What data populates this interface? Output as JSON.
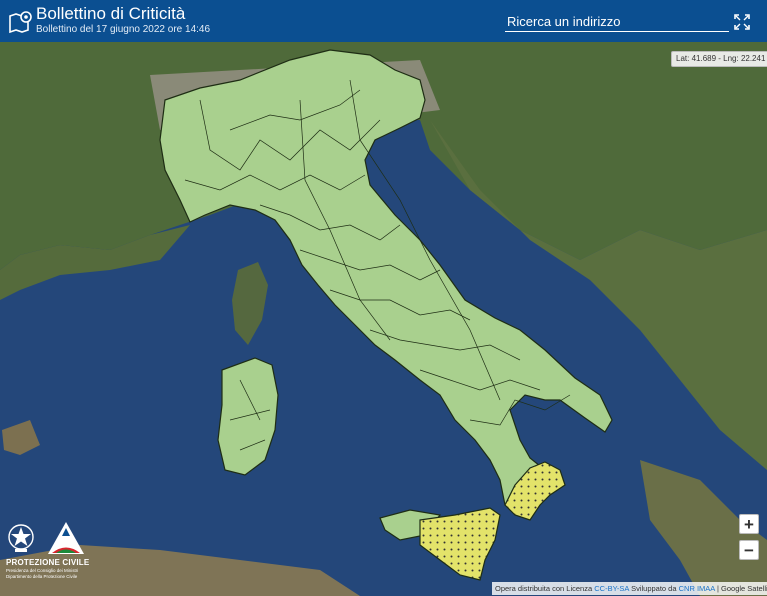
{
  "header": {
    "title": "Bollettino di Criticità",
    "subtitle": "Bollettino del 17 giugno 2022 ore 14:46",
    "search_placeholder": "Ricerca un indirizzo",
    "fullscreen_icon": "fullscreen-expand-icon",
    "logo_icon": "map-pin-icon"
  },
  "coords": {
    "text": "Lat: 41.689 - Lng: 22.241"
  },
  "zoom": {
    "in_label": "+",
    "out_label": "−"
  },
  "logo": {
    "seal_icon": "italian-republic-emblem-icon",
    "mark_icon": "protezione-civile-triangle-icon",
    "title": "PROTEZIONE CIVILE",
    "line1": "Presidenza del Consiglio dei Ministri",
    "line2": "Dipartimento della Protezione Civile"
  },
  "attribution": {
    "prefix": "Opera distribuita con Licenza",
    "license": "CC-BY-SA",
    "dev_prefix": "Sviluppato da",
    "developer": "CNR IMAA",
    "sep": "|",
    "tiles": "Google Satellite"
  },
  "legend_colors": {
    "no_criticality": "#a9d08e",
    "ordinary_criticality": "#e3e36a",
    "border": "#1e2d14"
  }
}
